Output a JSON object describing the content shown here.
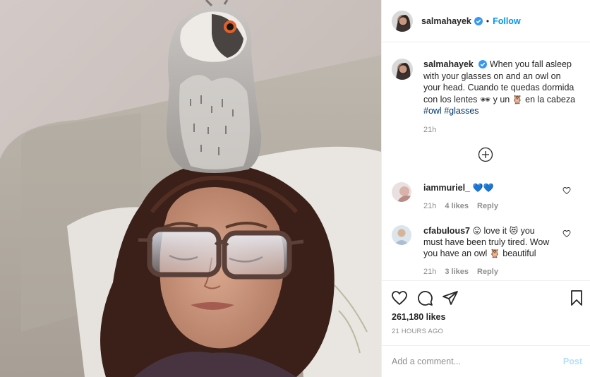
{
  "colors": {
    "accent": "#0095f6",
    "hashtag": "#00376b",
    "muted": "#8e8e8e",
    "post_disabled": "#b2dffc",
    "heart_blue": "#3897f0"
  },
  "header": {
    "username": "salmahayek",
    "separator": "•",
    "follow_label": "Follow"
  },
  "caption": {
    "username": "salmahayek",
    "text_1": "When you fall asleep with your glasses on and an owl on your head. Cuando te quedas dormida con los lentes ",
    "emoji_glasses": "🕶",
    "text_2": " y un ",
    "emoji_owl": "🦉",
    "text_3": " en la cabeza ",
    "hashtag_1": "#owl",
    "hashtag_2": "#glasses",
    "time": "21h"
  },
  "comments": [
    {
      "username": "iammuriel_",
      "text": "💙💙",
      "time": "21h",
      "likes": "4 likes",
      "reply": "Reply"
    },
    {
      "username": "cfabulous7",
      "emoji_1": "😛",
      "text_1": " love it ",
      "emoji_2": "😻",
      "text_2": " you must have been truly tired. Wow you have an owl ",
      "emoji_3": "🦉",
      "text_3": " beautiful",
      "time": "21h",
      "likes": "3 likes",
      "reply": "Reply"
    }
  ],
  "stats": {
    "likes": "261,180 likes",
    "timestamp": "21 HOURS AGO"
  },
  "composer": {
    "placeholder": "Add a comment...",
    "post_label": "Post"
  },
  "icons": [
    "verified-badge-icon",
    "load-more-plus-icon",
    "heart-icon",
    "comment-icon",
    "share-icon",
    "bookmark-icon"
  ]
}
